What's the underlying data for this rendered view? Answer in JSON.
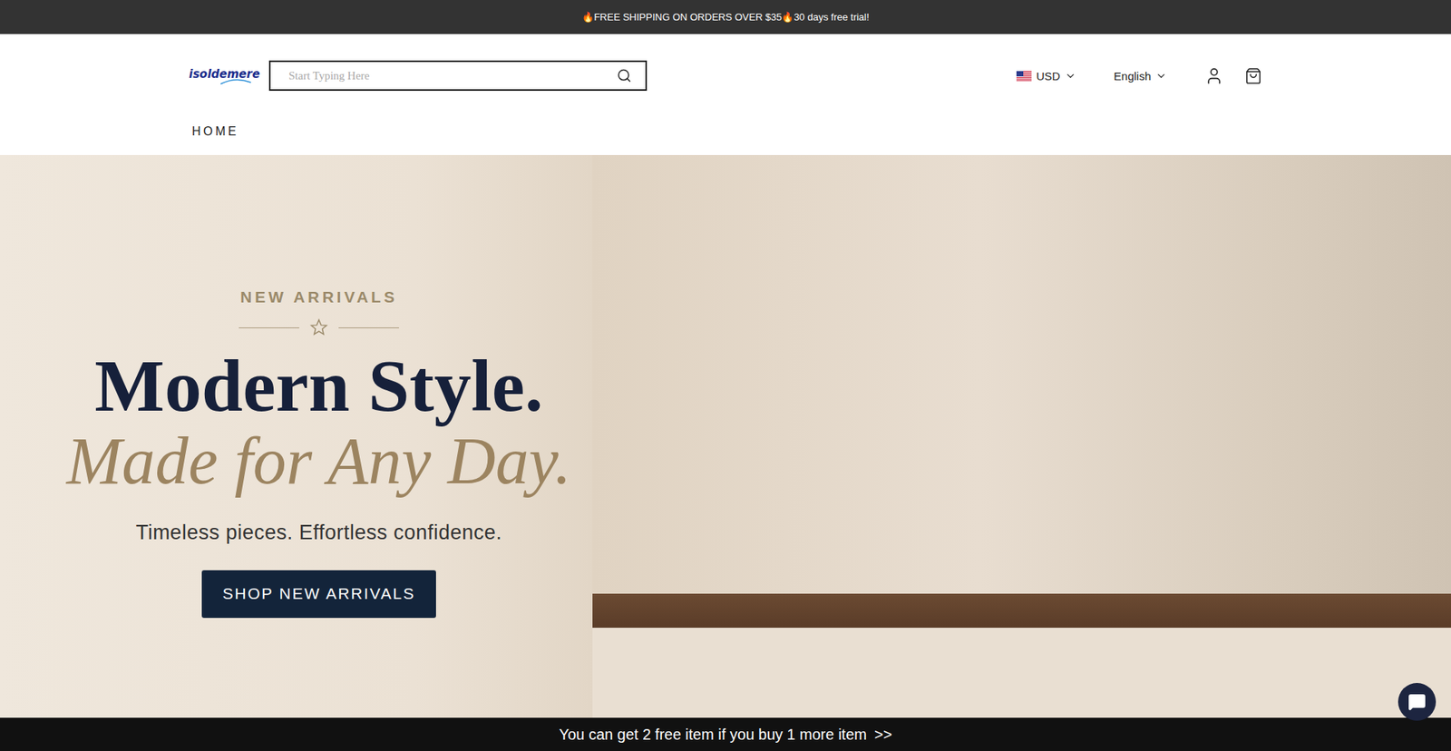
{
  "announcement": {
    "text": "🔥FREE SHIPPING ON ORDERS OVER $35🔥30 days free trial!"
  },
  "header": {
    "logo": "isoldemere",
    "search": {
      "placeholder": "Start Typing Here"
    },
    "currency": "USD",
    "language": "English"
  },
  "nav": [
    {
      "label": "HOME"
    }
  ],
  "hero": {
    "eyebrow": "NEW ARRIVALS",
    "title": "Modern Style.",
    "subtitle": "Made for Any Day.",
    "tagline": "Timeless pieces. Effortless confidence.",
    "button": "SHOP NEW ARRIVALS"
  },
  "promo_bar": {
    "text": "You can get 2 free item if you buy 1 more item",
    "arrow": ">>"
  }
}
